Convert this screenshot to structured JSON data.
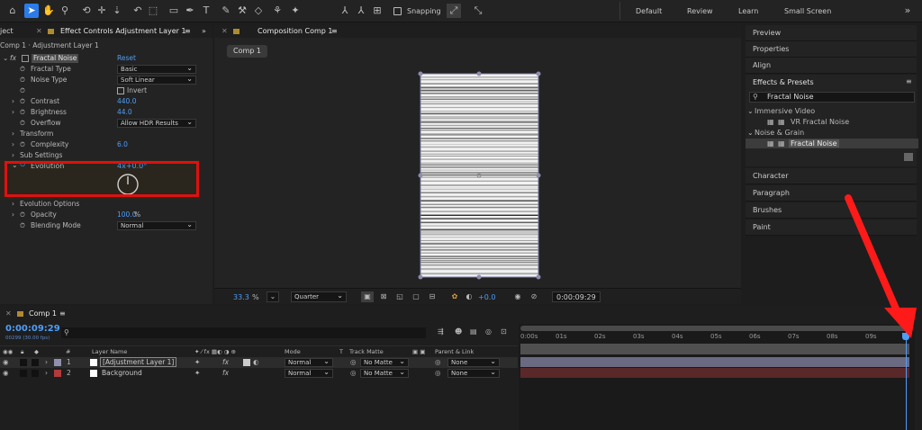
{
  "toolbar": {
    "snapping_label": "Snapping",
    "workspaces": [
      "Default",
      "Review",
      "Learn",
      "Small Screen"
    ]
  },
  "left_panel": {
    "tab_project": "ject",
    "tab_effect_controls": "Effect Controls Adjustment Layer 1",
    "subtitle": "Comp 1 · Adjustment Layer 1",
    "effect_name": "Fractal Noise",
    "reset_label": "Reset",
    "props": {
      "fractal_type": {
        "label": "Fractal Type",
        "value": "Basic"
      },
      "noise_type": {
        "label": "Noise Type",
        "value": "Soft Linear"
      },
      "invert": {
        "label": "Invert"
      },
      "contrast": {
        "label": "Contrast",
        "value": "440.0"
      },
      "brightness": {
        "label": "Brightness",
        "value": "44.0"
      },
      "overflow": {
        "label": "Overflow",
        "value": "Allow HDR Results"
      },
      "transform": {
        "label": "Transform"
      },
      "complexity": {
        "label": "Complexity",
        "value": "6.0"
      },
      "sub_settings": {
        "label": "Sub Settings"
      },
      "evolution": {
        "label": "Evolution",
        "value": "4x+0.0°"
      },
      "evolution_options": {
        "label": "Evolution Options"
      },
      "opacity": {
        "label": "Opacity",
        "value": "100.0",
        "unit": "%"
      },
      "blending_mode": {
        "label": "Blending Mode",
        "value": "Normal"
      }
    }
  },
  "composition": {
    "tab_label": "Composition Comp 1",
    "comp_chip": "Comp 1",
    "zoom": "33.3",
    "zoom_unit": "%",
    "resolution": "Quarter",
    "exposure": "+0.0",
    "timecode": "0:00:09:29"
  },
  "right_panel": {
    "preview": "Preview",
    "properties": "Properties",
    "align": "Align",
    "effects_presets": "Effects & Presets",
    "search_value": "Fractal Noise",
    "groups": [
      {
        "name": "Immersive Video",
        "items": [
          "VR Fractal Noise"
        ]
      },
      {
        "name": "Noise & Grain",
        "items": [
          "Fractal Noise"
        ]
      }
    ],
    "character": "Character",
    "paragraph": "Paragraph",
    "brushes": "Brushes",
    "paint": "Paint"
  },
  "timeline": {
    "tab_label": "Comp 1",
    "timecode": "0:00:09:29",
    "frames_info": "00299 (30.00 fps)",
    "col_hash": "#",
    "col_layer_name": "Layer Name",
    "col_mode": "Mode",
    "col_t": "T",
    "col_track_matte": "Track Matte",
    "col_parent": "Parent & Link",
    "ruler": [
      "0:00s",
      "01s",
      "02s",
      "03s",
      "04s",
      "05s",
      "06s",
      "07s",
      "08s",
      "09s"
    ],
    "playhead_fraction": 0.995,
    "layers": [
      {
        "num": "1",
        "name": "[Adjustment Layer 1]",
        "mode": "Normal",
        "matte": "No Matte",
        "parent": "None",
        "color": "#8f8fae"
      },
      {
        "num": "2",
        "name": "Background",
        "mode": "Normal",
        "matte": "No Matte",
        "parent": "None",
        "color": "#b23a3a"
      }
    ]
  },
  "colors": {
    "accent": "#2b7ce9",
    "highlight_box": "#e01010",
    "annotation_arrow": "#ff1a1a"
  }
}
